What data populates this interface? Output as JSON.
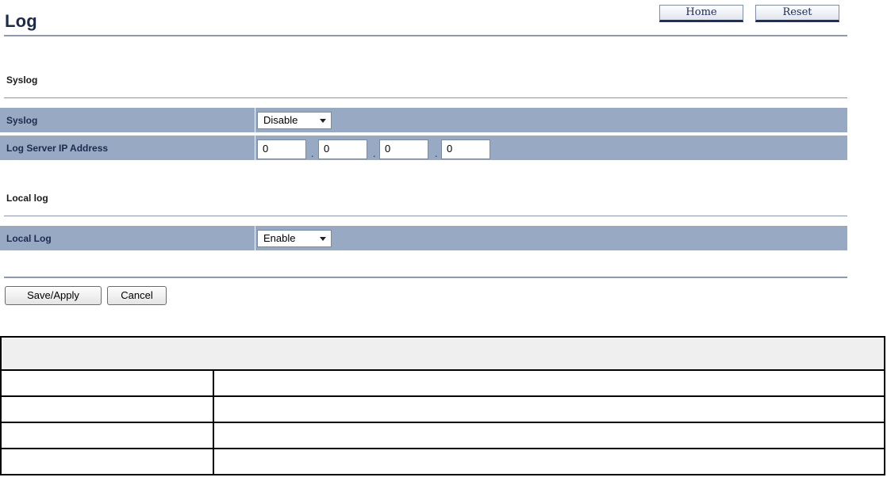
{
  "header": {
    "title": "Log",
    "home_label": "Home",
    "reset_label": "Reset"
  },
  "syslog_section": {
    "title": "Syslog",
    "syslog_label": "Syslog",
    "syslog_value": "Disable",
    "ip_label": "Log Server IP Address",
    "ip_octets": [
      "0",
      "0",
      "0",
      "0"
    ],
    "ip_separator": "."
  },
  "local_section": {
    "title": "Local log",
    "local_label": "Local Log",
    "local_value": "Enable"
  },
  "actions": {
    "save_label": "Save/Apply",
    "cancel_label": "Cancel"
  }
}
